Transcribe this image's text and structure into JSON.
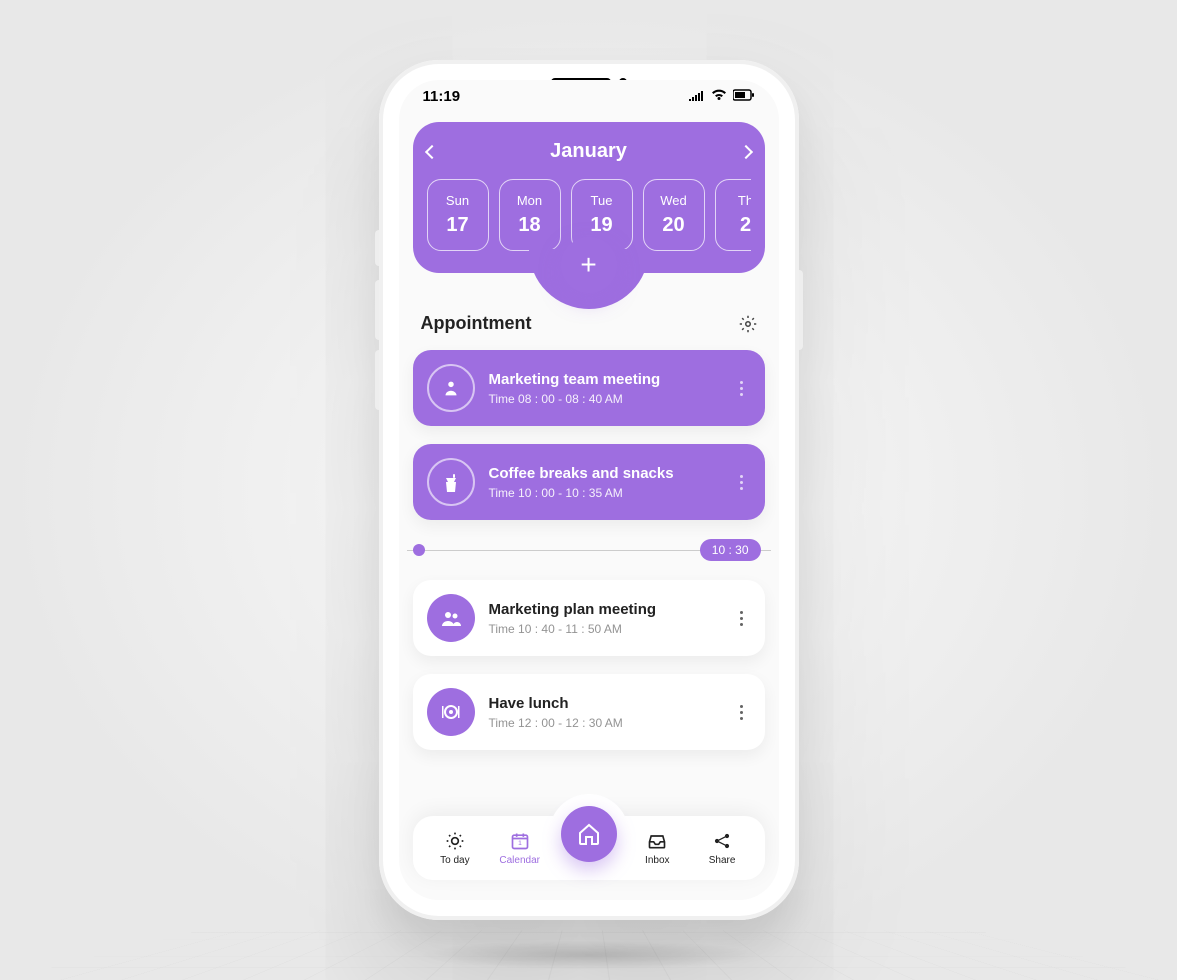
{
  "status": {
    "time": "11:19"
  },
  "calendar": {
    "month": "January",
    "days": [
      {
        "dow": "Sun",
        "num": "17",
        "active": false
      },
      {
        "dow": "Mon",
        "num": "18",
        "active": true
      },
      {
        "dow": "Tue",
        "num": "19",
        "active": false
      },
      {
        "dow": "Wed",
        "num": "20",
        "active": false
      },
      {
        "dow": "Th",
        "num": "2",
        "active": false
      }
    ]
  },
  "section": {
    "title": "Appointment"
  },
  "timeline": {
    "label": "10 : 30"
  },
  "appointments": [
    {
      "title": "Marketing team meeting",
      "time": "Time 08 : 00 - 08 : 40 AM",
      "variant": "purple",
      "icon": "person"
    },
    {
      "title": "Coffee breaks and snacks",
      "time": "Time 10 : 00 - 10 : 35 AM",
      "variant": "purple",
      "icon": "coffee"
    },
    {
      "title": "Marketing plan meeting",
      "time": "Time 10 : 40 - 11 : 50 AM",
      "variant": "white",
      "icon": "group"
    },
    {
      "title": "Have lunch",
      "time": "Time 12 : 00 - 12 : 30 AM",
      "variant": "white",
      "icon": "plate"
    }
  ],
  "nav": {
    "items": [
      {
        "label": "To day",
        "icon": "sun",
        "active": false
      },
      {
        "label": "Calendar",
        "icon": "cal",
        "active": true
      },
      {
        "label": "Inbox",
        "icon": "inbox",
        "active": false
      },
      {
        "label": "Share",
        "icon": "share",
        "active": false
      }
    ]
  },
  "colors": {
    "accent": "#9e6ee0"
  }
}
